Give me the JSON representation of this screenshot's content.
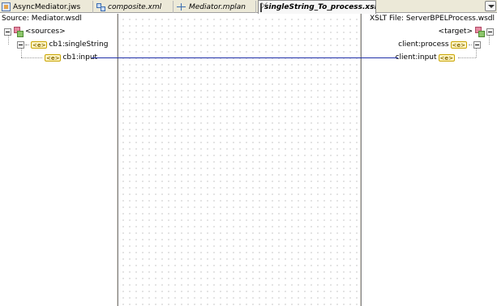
{
  "tabs": [
    {
      "label": "AsyncMediator.jws",
      "icon": "jws-file-icon",
      "active": false
    },
    {
      "label": "composite.xml",
      "icon": "composite-xml-icon",
      "active": false
    },
    {
      "label": "Mediator.mplan",
      "icon": "mediator-plan-icon",
      "active": false
    },
    {
      "label": "singleString_To_process.xsl",
      "icon": "xsl-map-icon",
      "active": true
    }
  ],
  "source": {
    "title": "Source: Mediator.wsdl",
    "tree": {
      "root": "<sources>",
      "child": "cb1:singleString",
      "leaf": "cb1:input"
    }
  },
  "target": {
    "title": "XSLT File: ServerBPELProcess.wsdl",
    "tree": {
      "root": "<target>",
      "child": "client:process",
      "leaf": "client:input"
    }
  },
  "colors": {
    "mapping_line": "#1f2fa8",
    "element_badge": "#c9a400"
  },
  "icons": {
    "element": "<e>"
  }
}
